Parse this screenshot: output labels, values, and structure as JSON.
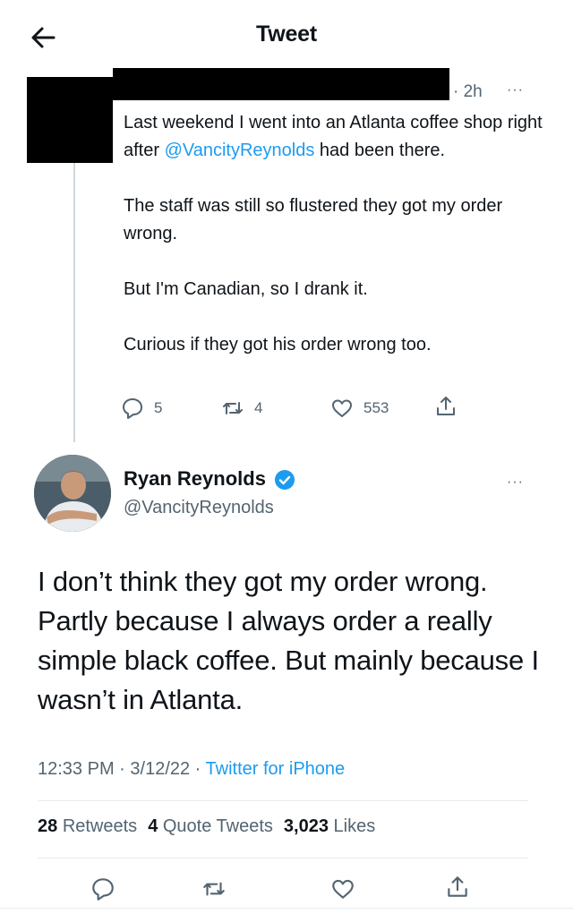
{
  "header": {
    "title": "Tweet",
    "back_icon": "arrow-left-icon"
  },
  "reply": {
    "time": "· 2h",
    "more": "···",
    "text": {
      "p1_before": "Last weekend I went into an Atlanta coffee shop right after ",
      "p1_mention": "@VancityReynolds",
      "p1_after": " had been there.",
      "p2": "The staff was still so flustered they got my order wrong.",
      "p3": "But I'm Canadian, so I drank it.",
      "p4": "Curious if they got his order wrong too."
    },
    "actions": {
      "replies": "5",
      "retweets": "4",
      "likes": "553"
    }
  },
  "tweet": {
    "author": {
      "name": "Ryan Reynolds",
      "handle": "@VancityReynolds",
      "verified": true
    },
    "more": "···",
    "text": "I don’t think they got my order wrong. Partly because I always order a really simple black coffee. But mainly because I wasn’t in Atlanta.",
    "meta": {
      "time": "12:33 PM",
      "sep1": " · ",
      "date": "3/12/22",
      "sep2": " · ",
      "source": "Twitter for iPhone"
    },
    "stats": {
      "retweets_count": "28",
      "retweets_label": "Retweets",
      "quotes_count": "4",
      "quotes_label": "Quote Tweets",
      "likes_count": "3,023",
      "likes_label": "Likes"
    }
  },
  "colors": {
    "accent": "#1d9bf0",
    "secondary_text": "#536471",
    "primary_text": "#0f1419"
  },
  "icons": [
    "arrow-left-icon",
    "more-icon",
    "reply-icon",
    "retweet-icon",
    "like-icon",
    "share-icon",
    "verified-icon"
  ]
}
